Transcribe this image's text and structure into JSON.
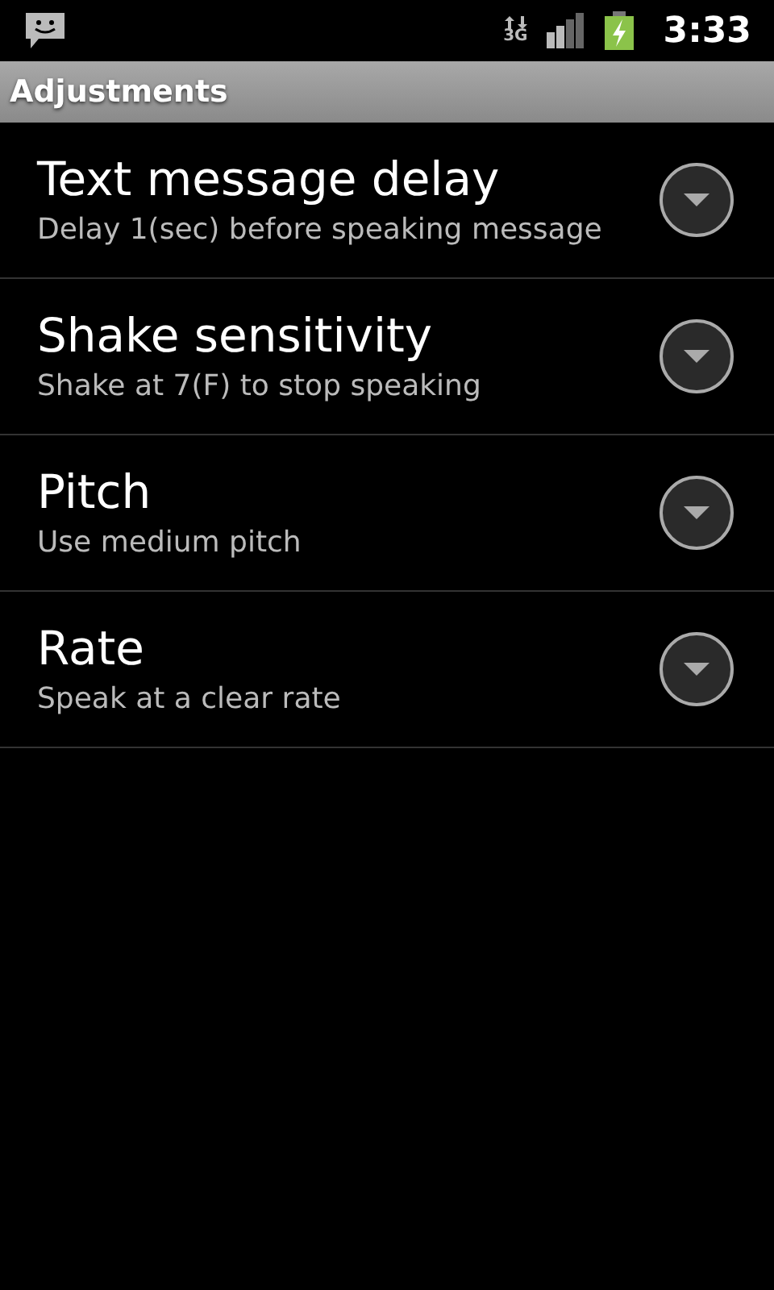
{
  "status_bar": {
    "network": "3G",
    "time": "3:33"
  },
  "title_bar": {
    "title": "Adjustments"
  },
  "settings": [
    {
      "title": "Text message delay",
      "summary": "Delay 1(sec) before speaking message"
    },
    {
      "title": "Shake sensitivity",
      "summary": "Shake at 7(F) to stop speaking"
    },
    {
      "title": "Pitch",
      "summary": "Use medium pitch"
    },
    {
      "title": "Rate",
      "summary": "Speak at a clear rate"
    }
  ]
}
